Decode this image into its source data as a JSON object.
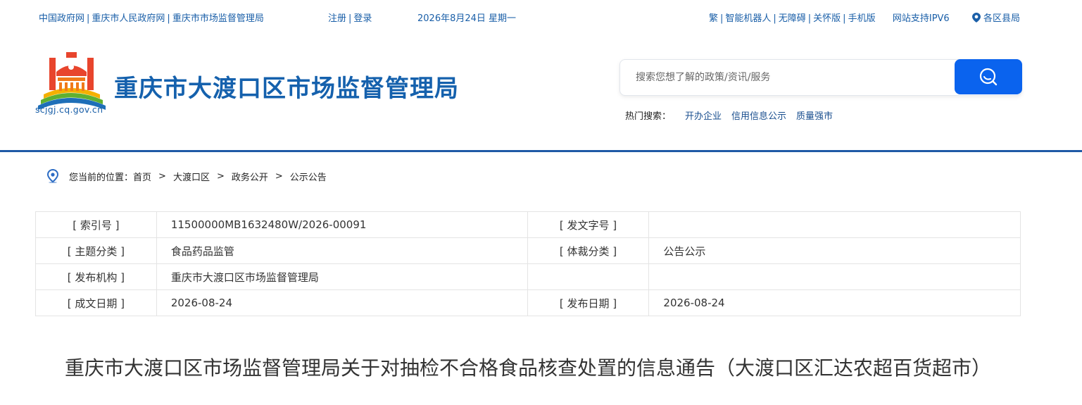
{
  "topbar": {
    "gov_links": [
      "中国政府网",
      "重庆市人民政府网",
      "重庆市市场监督管理局"
    ],
    "register": "注册",
    "login": "登录",
    "date": "2026年8月24日 星期一",
    "tools": [
      "繁",
      "智能机器人",
      "无障碍",
      "关怀版",
      "手机版"
    ],
    "ipv6": "网站支持IPV6",
    "districts": "各区县局"
  },
  "header": {
    "domain": "scjgj.cq.gov.cn",
    "site_title": "重庆市大渡口区市场监督管理局",
    "search_placeholder": "搜索您想了解的政策/资讯/服务",
    "hot_label": "热门搜索：",
    "hot_items": [
      "开办企业",
      "信用信息公示",
      "质量强市"
    ]
  },
  "breadcrumb": {
    "prefix": "您当前的位置：",
    "items": [
      "首页",
      "大渡口区",
      "政务公开",
      "公示公告"
    ],
    "separator": ">"
  },
  "meta": {
    "rows": [
      {
        "k1": "[ 索引号 ]",
        "v1": "11500000MB1632480W/2026-00091",
        "k2": "[ 发文字号 ]",
        "v2": ""
      },
      {
        "k1": "[ 主题分类 ]",
        "v1": "食品药品监管",
        "k2": "[ 体裁分类 ]",
        "v2": "公告公示"
      },
      {
        "k1": "[ 发布机构 ]",
        "v1": "重庆市大渡口区市场监督管理局",
        "k2": "",
        "v2": ""
      },
      {
        "k1": "[ 成文日期 ]",
        "v1": "2026-08-24",
        "k2": "[ 发布日期 ]",
        "v2": "2026-08-24"
      }
    ]
  },
  "article": {
    "title": "重庆市大渡口区市场监督管理局关于对抽检不合格食品核查处置的信息通告（大渡口区汇达农超百货超市）"
  },
  "colors": {
    "brand_blue": "#1561ad",
    "link_blue": "#1a5fa8",
    "search_button": "#0a63ee",
    "divider": "#1f5aa6"
  }
}
